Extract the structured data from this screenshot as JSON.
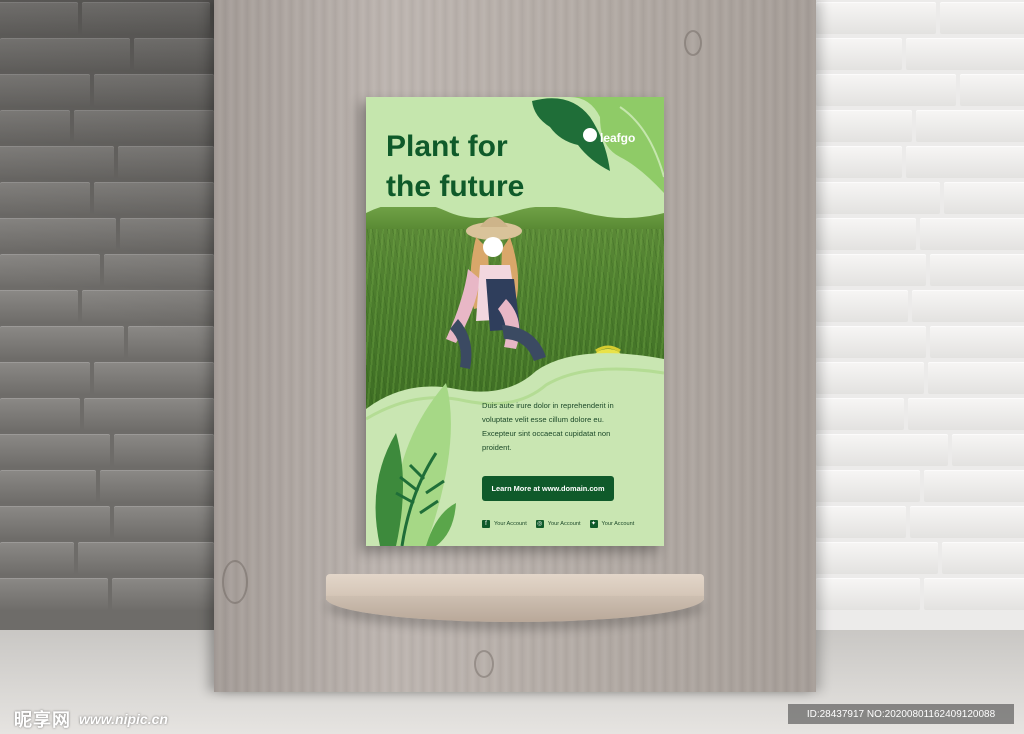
{
  "poster": {
    "headline_line1": "Plant for",
    "headline_line2": "the future",
    "brand": "leafgo",
    "body_lines": [
      "Duis aute irure dolor in reprehenderit in",
      "voluptate velit esse cillum dolore eu.",
      "Excepteur sint occaecat cupidatat non",
      "proident."
    ],
    "cta_label": "Learn More at www.domain.com",
    "socials": [
      {
        "icon": "facebook-icon",
        "label": "Your Account"
      },
      {
        "icon": "instagram-icon",
        "label": "Your Account"
      },
      {
        "icon": "twitter-icon",
        "label": "Your Account"
      }
    ]
  },
  "watermark": {
    "site_logo": "昵享网",
    "site_url": "www.nipic.cn",
    "id_text": "ID:28437917 NO:20200801162409120088"
  },
  "colors": {
    "poster_bg": "#c9e6b2",
    "brand_green": "#0f5a2a",
    "leaf_green": "#7bbf5a"
  }
}
